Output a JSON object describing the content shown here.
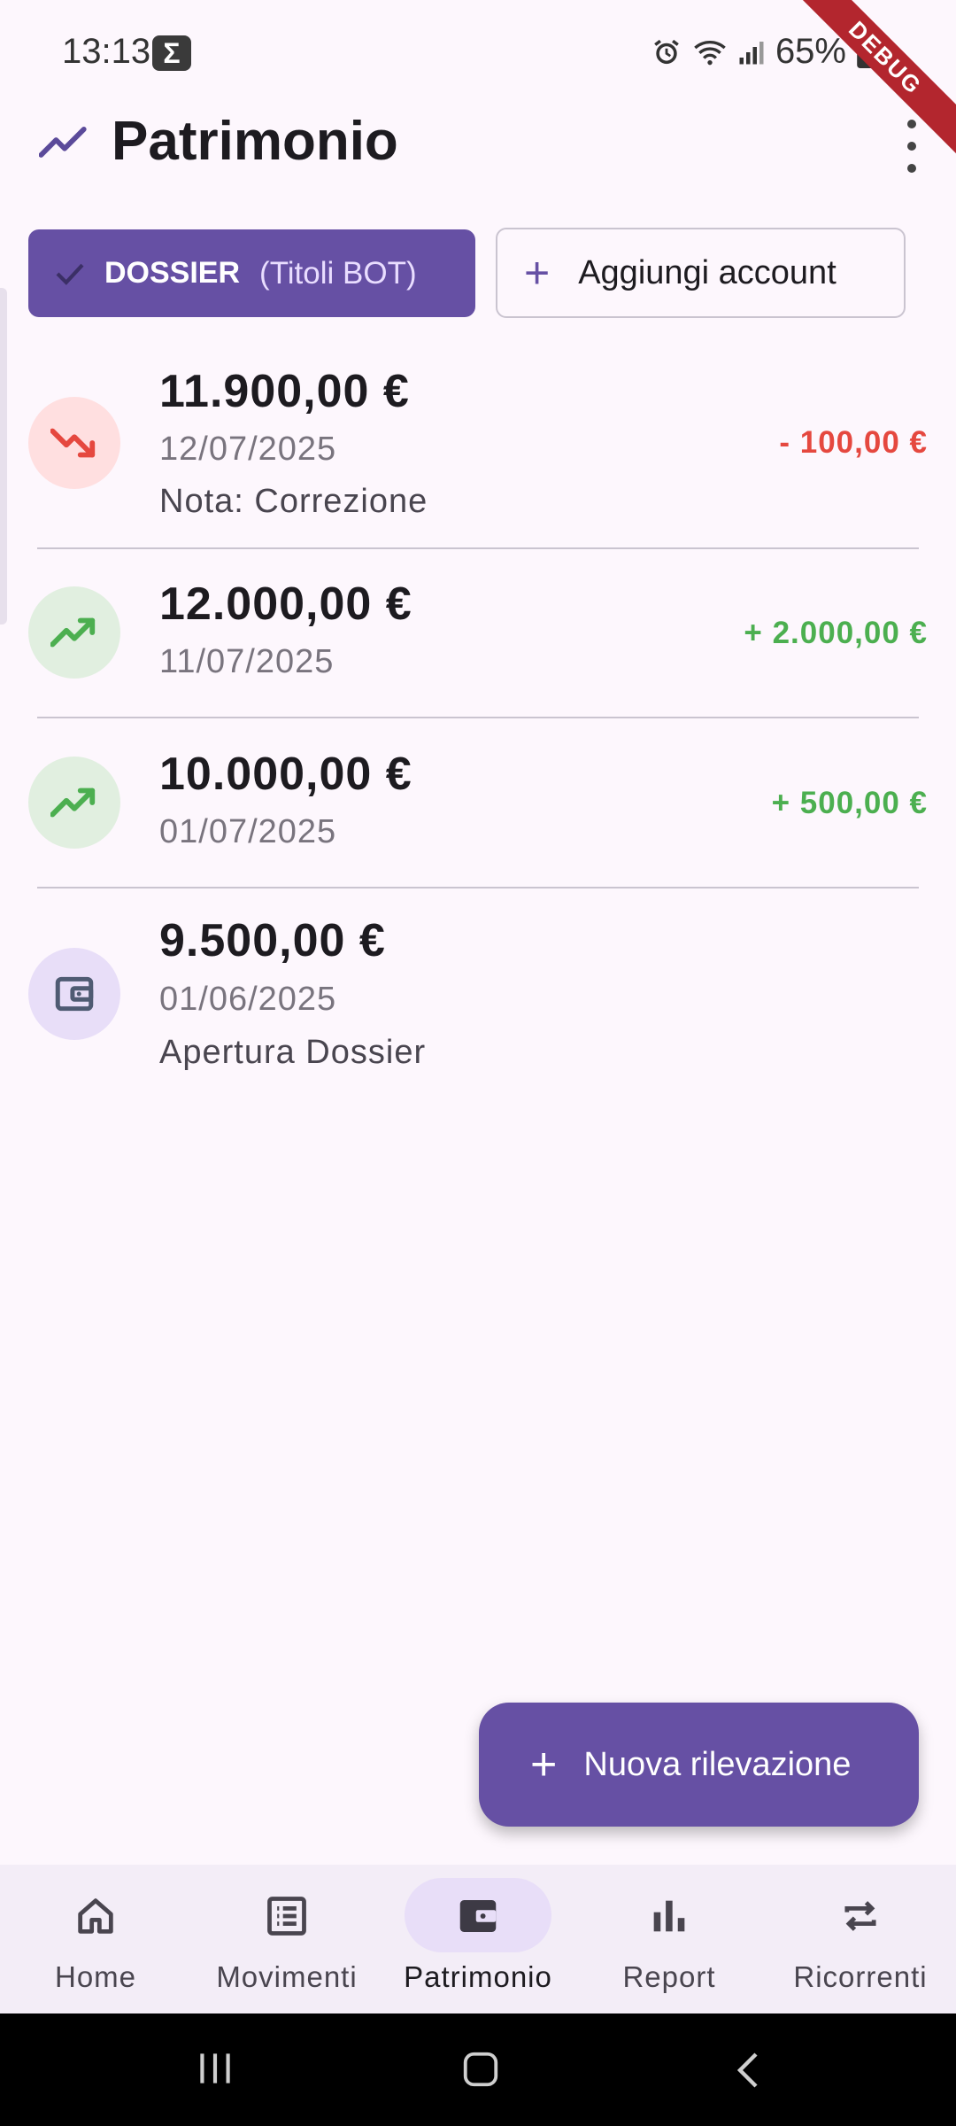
{
  "status_bar": {
    "time": "13:13",
    "battery": "65%",
    "debug_label": "DEBUG"
  },
  "header": {
    "title": "Patrimonio"
  },
  "accounts": {
    "selected": {
      "name": "DOSSIER",
      "subtitle": "(Titoli BOT)"
    },
    "add_label": "Aggiungi account"
  },
  "entries": [
    {
      "amount": "11.900,00 €",
      "date": "12/07/2025",
      "note": "Nota: Correzione",
      "delta": "- 100,00 €",
      "trend": "down",
      "icon": "trending-down-icon"
    },
    {
      "amount": "12.000,00 €",
      "date": "11/07/2025",
      "note": "",
      "delta": "+ 2.000,00 €",
      "trend": "up",
      "icon": "trending-up-icon"
    },
    {
      "amount": "10.000,00 €",
      "date": "01/07/2025",
      "note": "",
      "delta": "+ 500,00 €",
      "trend": "up",
      "icon": "trending-up-icon"
    },
    {
      "amount": "9.500,00 €",
      "date": "01/06/2025",
      "note": "Apertura Dossier",
      "delta": "",
      "trend": "initial",
      "icon": "wallet-icon"
    }
  ],
  "fab": {
    "label": "Nuova rilevazione"
  },
  "bottom_nav": [
    {
      "label": "Home",
      "icon": "home-icon"
    },
    {
      "label": "Movimenti",
      "icon": "list-icon"
    },
    {
      "label": "Patrimonio",
      "icon": "wallet-icon",
      "active": true
    },
    {
      "label": "Report",
      "icon": "bar-chart-icon"
    },
    {
      "label": "Ricorrenti",
      "icon": "repeat-icon"
    }
  ],
  "colors": {
    "primary": "#6650a4",
    "negative": "#e5483f",
    "positive": "#4caf50",
    "background": "#fdf7fd"
  }
}
